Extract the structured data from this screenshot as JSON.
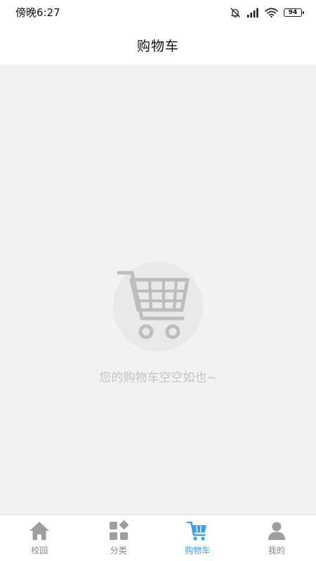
{
  "status_bar": {
    "time": "傍晚6:27",
    "battery_level": "94",
    "icons": [
      "bell-muted-icon",
      "signal-icon",
      "wifi-icon",
      "battery-icon"
    ]
  },
  "header": {
    "title": "购物车"
  },
  "empty_state": {
    "icon": "shopping-cart-icon",
    "message": "您的购物车空空如也~"
  },
  "tab_bar": {
    "active_color": "#3e9ee8",
    "inactive_color": "#888888",
    "tabs": [
      {
        "label": "校园",
        "icon": "home-icon",
        "active": false
      },
      {
        "label": "分类",
        "icon": "category-icon",
        "active": false
      },
      {
        "label": "购物车",
        "icon": "cart-icon",
        "active": true
      },
      {
        "label": "我的",
        "icon": "user-icon",
        "active": false
      }
    ]
  }
}
